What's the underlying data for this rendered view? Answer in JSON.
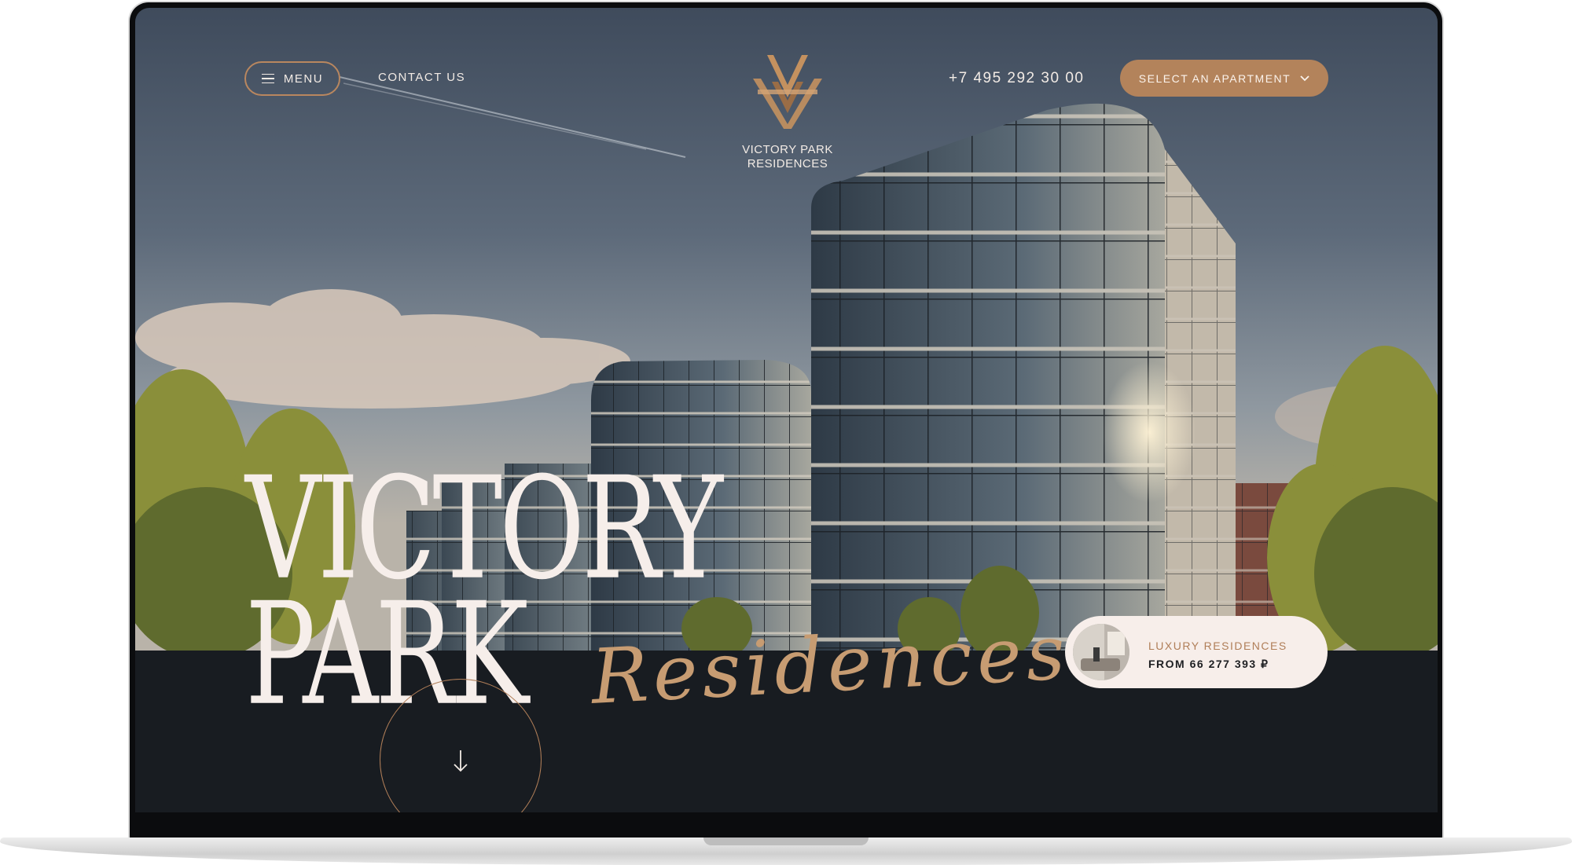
{
  "header": {
    "menu_label": "MENU",
    "contact_label": "CONTACT US",
    "logo_line1": "VICTORY PARK",
    "logo_line2": "RESIDENCES",
    "phone": "+7 495 292 30 00",
    "select_label": "SELECT AN APARTMENT"
  },
  "hero": {
    "title_line1": "VICTORY",
    "title_line2": "PARK",
    "title_script": "Residences"
  },
  "card": {
    "title": "LUXURY RESIDENCES",
    "price": "FROM 66 277 393 ₽"
  },
  "colors": {
    "accent": "#b3835b",
    "accent_light": "#c79c72",
    "dark": "#181c21",
    "cream": "#f6eeea"
  },
  "icons": [
    "menu-icon",
    "chevron-down-icon",
    "arrow-down-icon",
    "logo-mark"
  ]
}
